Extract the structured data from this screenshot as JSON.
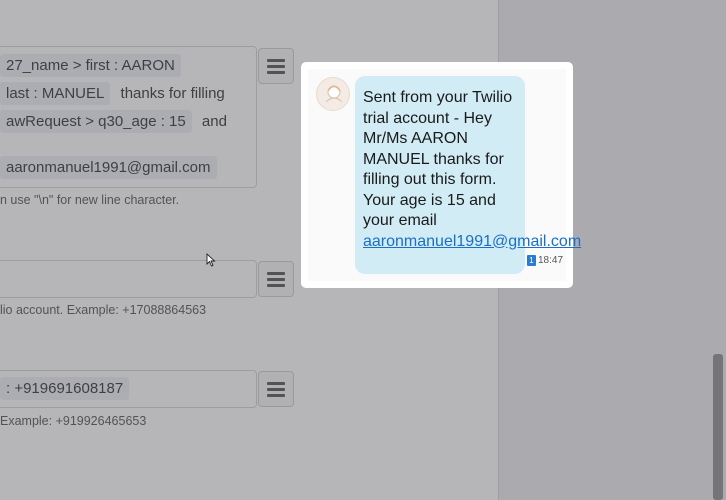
{
  "form": {
    "message_field": {
      "line1": {
        "chip": "27_name > first : AARON"
      },
      "line2": {
        "chip": "last : MANUEL",
        "text": "thanks for filling"
      },
      "line3": {
        "chip": "awRequest > q30_age : 15",
        "text": "and"
      },
      "line4": {
        "chip": "aaronmanuel1991@gmail.com"
      },
      "hint": "n use \"\\n\" for new line character."
    },
    "from_field": {
      "value": "",
      "hint": "lio account. Example: +17088864563"
    },
    "to_field": {
      "chip": ": +919691608187",
      "hint": "Example: +919926465653"
    }
  },
  "sms_preview": {
    "message_text": "Sent from your Twilio trial account - Hey Mr/Ms AARON MANUEL thanks for filling out this form. Your age is 15 and your email",
    "email_link": "aaronmanuel1991@gmail.com",
    "badge": "1",
    "time": "18:47"
  },
  "icons": [
    "menu-icon",
    "avatar-icon",
    "cursor-icon"
  ]
}
